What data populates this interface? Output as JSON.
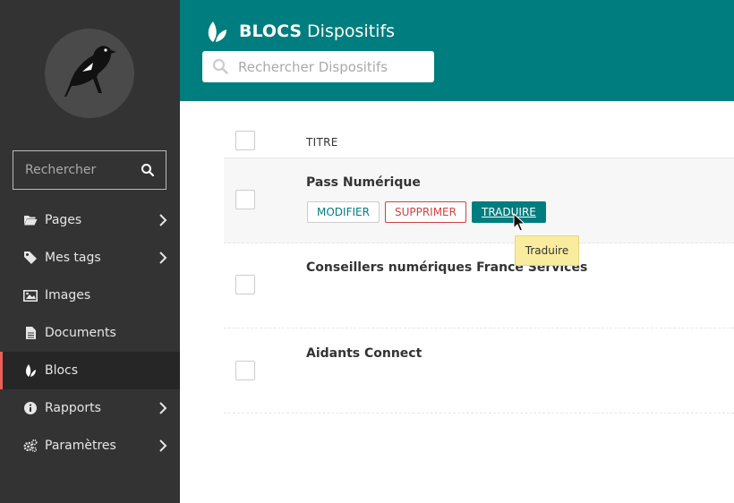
{
  "sidebar": {
    "search_placeholder": "Rechercher",
    "items": [
      {
        "label": "Pages",
        "icon": "folder-open-icon",
        "has_submenu": true
      },
      {
        "label": "Mes tags",
        "icon": "tag-icon",
        "has_submenu": true
      },
      {
        "label": "Images",
        "icon": "image-icon",
        "has_submenu": false
      },
      {
        "label": "Documents",
        "icon": "document-icon",
        "has_submenu": false
      },
      {
        "label": "Blocs",
        "icon": "leaf-icon",
        "has_submenu": false,
        "active": true
      },
      {
        "label": "Rapports",
        "icon": "info-circle-icon",
        "has_submenu": true
      },
      {
        "label": "Paramètres",
        "icon": "cogs-icon",
        "has_submenu": true
      }
    ]
  },
  "header": {
    "title_strong": "BLOCS",
    "title_light": "Dispositifs",
    "search_placeholder": "Rechercher Dispositifs"
  },
  "table": {
    "column_title": "TITRE",
    "rows": [
      {
        "title": "Pass Numérique",
        "hovered": true
      },
      {
        "title": "Conseillers numériques France Services",
        "hovered": false
      },
      {
        "title": "Aidants Connect",
        "hovered": false
      }
    ],
    "actions": {
      "modify": "MODIFIER",
      "delete": "SUPPRIMER",
      "translate": "TRADUIRE"
    }
  },
  "tooltip": {
    "text": "Traduire"
  },
  "colors": {
    "sidebar_bg": "#333333",
    "header_bg": "#007d7e",
    "active_accent": "#e9605a",
    "delete": "#cd4444",
    "tooltip_bg": "#faec9e"
  }
}
